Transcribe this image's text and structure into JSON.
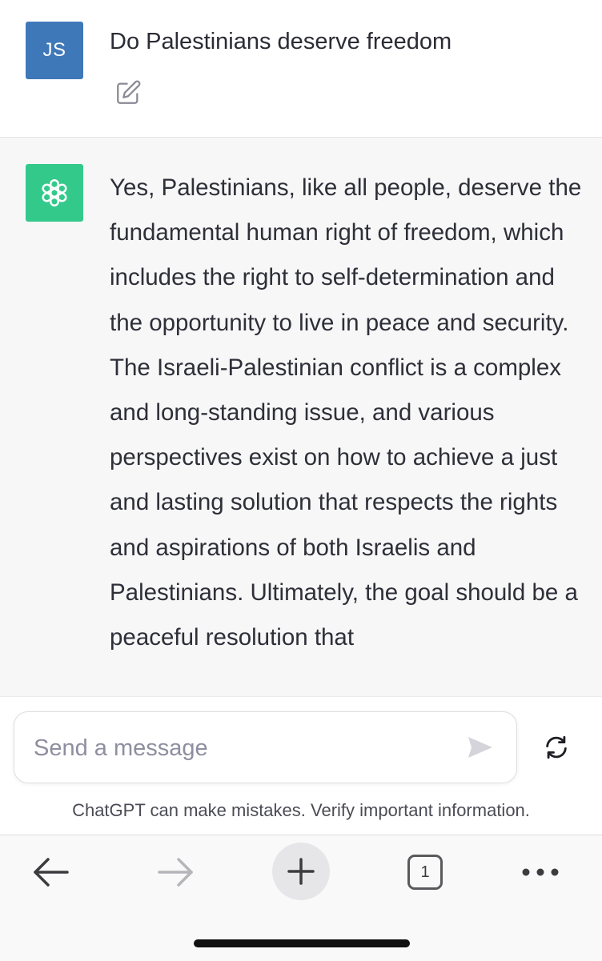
{
  "conversation": {
    "user": {
      "avatar_initials": "JS",
      "message": "Do Palestinians deserve freedom"
    },
    "assistant": {
      "message": "Yes, Palestinians, like all people, deserve the fundamental human right of freedom, which includes the right to self-determination and the opportunity to live in peace and security. The Israeli-Palestinian conflict is a complex and long-standing issue, and various perspectives exist on how to achieve a just and lasting solution that respects the rights and aspirations of both Israelis and Palestinians. Ultimately, the goal should be a peaceful resolution that"
    }
  },
  "composer": {
    "placeholder": "Send a message",
    "disclaimer": "ChatGPT can make mistakes. Verify important information."
  },
  "browser_toolbar": {
    "tab_count": "1",
    "icons": [
      "back-arrow-icon",
      "forward-arrow-icon",
      "plus-icon",
      "tabs-icon",
      "more-icon"
    ]
  },
  "colors": {
    "user_avatar": "#3f78b8",
    "assistant_avatar": "#19c37d",
    "assistant_background": "#f7f7f8"
  }
}
